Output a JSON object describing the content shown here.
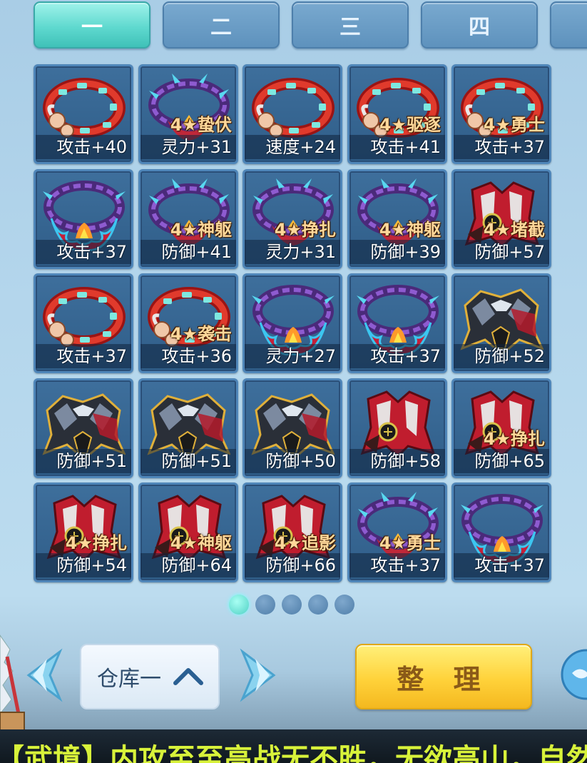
{
  "tabs": [
    {
      "label": "一",
      "active": true
    },
    {
      "label": "二",
      "active": false
    },
    {
      "label": "三",
      "active": false
    },
    {
      "label": "四",
      "active": false
    }
  ],
  "items": [
    {
      "icon": "red-bracelet",
      "tag": "",
      "stat": "攻击+40"
    },
    {
      "icon": "purple-necklace",
      "tag": "4★蛰伏",
      "stat": "灵力+31"
    },
    {
      "icon": "red-bracelet",
      "tag": "",
      "stat": "速度+24"
    },
    {
      "icon": "red-bracelet",
      "tag": "4★驱逐",
      "stat": "攻击+41"
    },
    {
      "icon": "red-bracelet",
      "tag": "4★勇士",
      "stat": "攻击+37"
    },
    {
      "icon": "flame-necklace",
      "tag": "",
      "stat": "攻击+37"
    },
    {
      "icon": "purple-necklace",
      "tag": "4★神躯",
      "stat": "防御+41"
    },
    {
      "icon": "purple-necklace",
      "tag": "4★挣扎",
      "stat": "灵力+31"
    },
    {
      "icon": "purple-necklace",
      "tag": "4★神躯",
      "stat": "防御+39"
    },
    {
      "icon": "red-armor",
      "tag": "4★堵截",
      "stat": "防御+57"
    },
    {
      "icon": "red-bracelet",
      "tag": "",
      "stat": "攻击+37"
    },
    {
      "icon": "red-bracelet",
      "tag": "4★袭击",
      "stat": "攻击+36"
    },
    {
      "icon": "flame-necklace",
      "tag": "",
      "stat": "灵力+27"
    },
    {
      "icon": "flame-necklace",
      "tag": "",
      "stat": "攻击+37"
    },
    {
      "icon": "dark-armor",
      "tag": "",
      "stat": "防御+52"
    },
    {
      "icon": "dark-armor",
      "tag": "",
      "stat": "防御+51"
    },
    {
      "icon": "dark-armor",
      "tag": "",
      "stat": "防御+51"
    },
    {
      "icon": "dark-armor",
      "tag": "",
      "stat": "防御+50"
    },
    {
      "icon": "red-armor",
      "tag": "",
      "stat": "防御+58"
    },
    {
      "icon": "red-armor",
      "tag": "4★挣扎",
      "stat": "防御+65"
    },
    {
      "icon": "red-armor",
      "tag": "4★挣扎",
      "stat": "防御+54"
    },
    {
      "icon": "red-armor",
      "tag": "4★神躯",
      "stat": "防御+64"
    },
    {
      "icon": "red-armor",
      "tag": "4★追影",
      "stat": "防御+66"
    },
    {
      "icon": "purple-necklace",
      "tag": "4★勇士",
      "stat": "攻击+37"
    },
    {
      "icon": "flame-necklace",
      "tag": "",
      "stat": "攻击+37"
    }
  ],
  "pagination": {
    "total": 5,
    "current": 1
  },
  "storage": {
    "label": "仓库一",
    "icon": "chevron-up-icon"
  },
  "nav": {
    "prev_icon": "arrow-left-icon",
    "next_icon": "arrow-right-icon"
  },
  "sort_button": {
    "label": "整 理"
  },
  "ticker": {
    "text": "【武境】内攻至至高战无不胜，无欲高山，自然"
  },
  "colors": {
    "active_tab": "#5fd9cf",
    "tab": "#6a9cc6",
    "sort_button": "#ffd23a",
    "stat_text": "#ffffff",
    "tag_text": "#ffd89a",
    "ticker_text": "#d8f23a"
  }
}
